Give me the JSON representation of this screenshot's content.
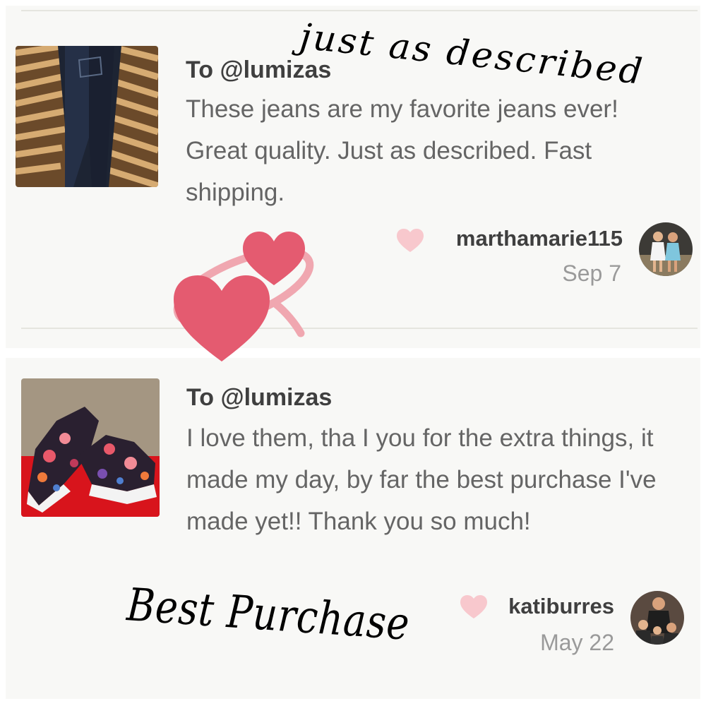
{
  "reviews": [
    {
      "recipient": "To @lumizas",
      "comment": "These jeans are my favorite jeans ever! Great quality. Just as described. Fast shipping.",
      "username": "marthamarie115",
      "date": "Sep 7",
      "thumbnail_icon": "jeans-photo",
      "avatar_icon": "user-photo"
    },
    {
      "recipient": "To @lumizas",
      "comment": "I love them, tha I you for the extra things, it made my day, by far the best purchase I've made yet!! Thank you so much!",
      "username": "katiburres",
      "date": "May 22",
      "thumbnail_icon": "sneakers-photo",
      "avatar_icon": "user-photo"
    }
  ],
  "annotations": {
    "top_handwriting": "just as described",
    "bottom_handwriting": "Best Purchase"
  },
  "decorations": {
    "sticker": "two-hearts-emoji"
  },
  "colors": {
    "card_background": "#f8f8f6",
    "divider": "#e5e5df",
    "small_heart": "#f8c8cd",
    "sticker_heart": "#e45b70",
    "sticker_ring": "#f0a7b0"
  }
}
